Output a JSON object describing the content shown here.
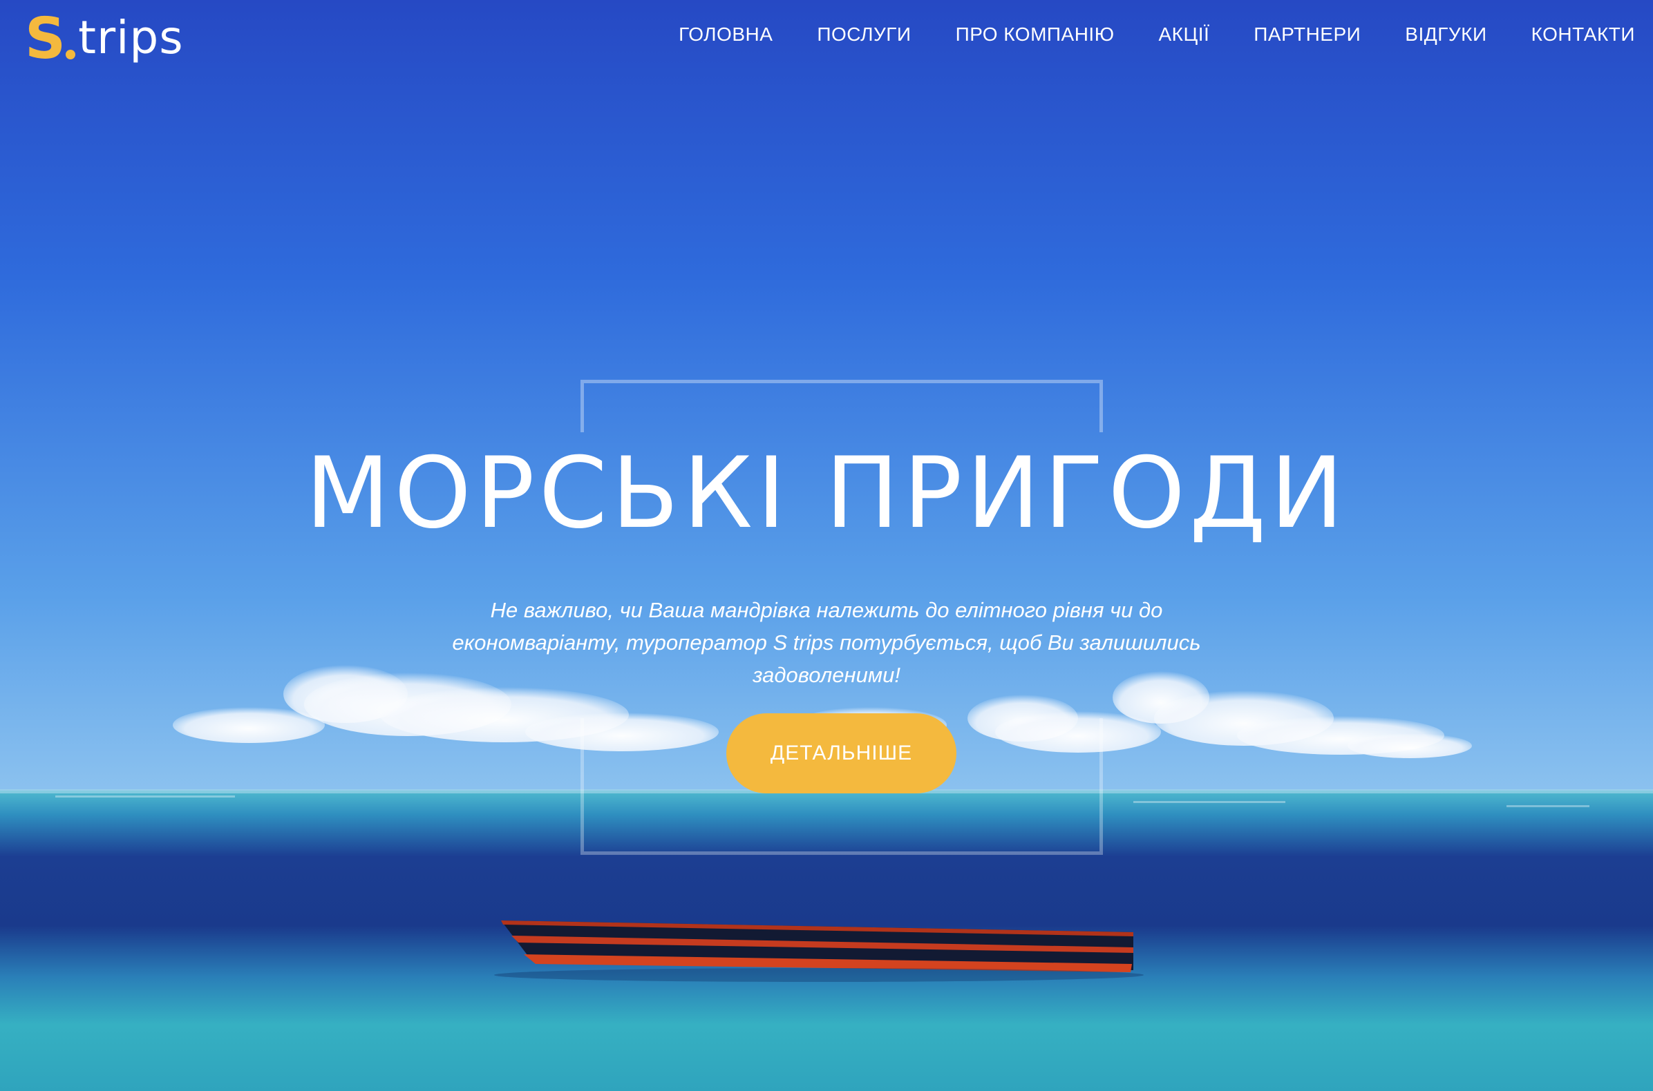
{
  "brand": {
    "logo_letter": "S",
    "logo_word": "trips"
  },
  "nav": {
    "items": [
      {
        "label": "ГОЛОВНА"
      },
      {
        "label": "ПОСЛУГИ"
      },
      {
        "label": "ПРО КОМПАНІЮ"
      },
      {
        "label": "АКЦІЇ"
      },
      {
        "label": "ПАРТНЕРИ"
      },
      {
        "label": "ВІДГУКИ"
      },
      {
        "label": "КОНТАКТИ"
      }
    ]
  },
  "hero": {
    "title": "МОРСЬКІ ПРИГОДИ",
    "subtitle_lines": [
      "Не важливо, чи Ваша мандрівка належить до елітного рівня чи до",
      "економваріанту, туроператор S trips потурбується, щоб Ви залишились",
      "задоволеними!"
    ],
    "cta_label": "ДЕТАЛЬНІШЕ"
  },
  "colors": {
    "accent": "#f4b93e",
    "sky_top": "#2a55c9",
    "sky_horizon": "#7fb6ec",
    "sea_dark": "#1a3b8a",
    "sea_turquoise": "#35b3c4"
  },
  "background": {
    "description_icons": [
      "clouds-image",
      "sea-image",
      "boat-image"
    ]
  }
}
